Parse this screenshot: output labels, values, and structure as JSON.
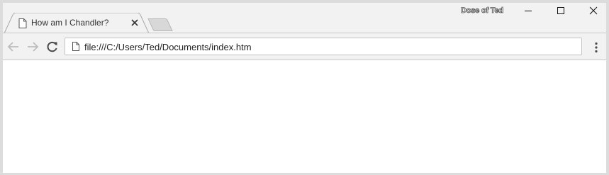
{
  "tab": {
    "title": "How am I Chandler?",
    "favicon": "page-icon",
    "close_icon": "close-icon"
  },
  "window": {
    "profile_name": "Dose of Ted",
    "minimize_icon": "minimize-icon",
    "maximize_icon": "maximize-icon",
    "close_icon": "close-icon"
  },
  "toolbar": {
    "back_icon": "arrow-left-icon",
    "forward_icon": "arrow-right-icon",
    "reload_icon": "reload-icon",
    "menu_icon": "kebab-menu-icon"
  },
  "omnibox": {
    "url": "file:///C:/Users/Ted/Documents/index.htm",
    "page_icon": "page-icon"
  },
  "colors": {
    "frame": "#f2f2f2",
    "content": "#ffffff",
    "border": "#c8c8c8"
  }
}
